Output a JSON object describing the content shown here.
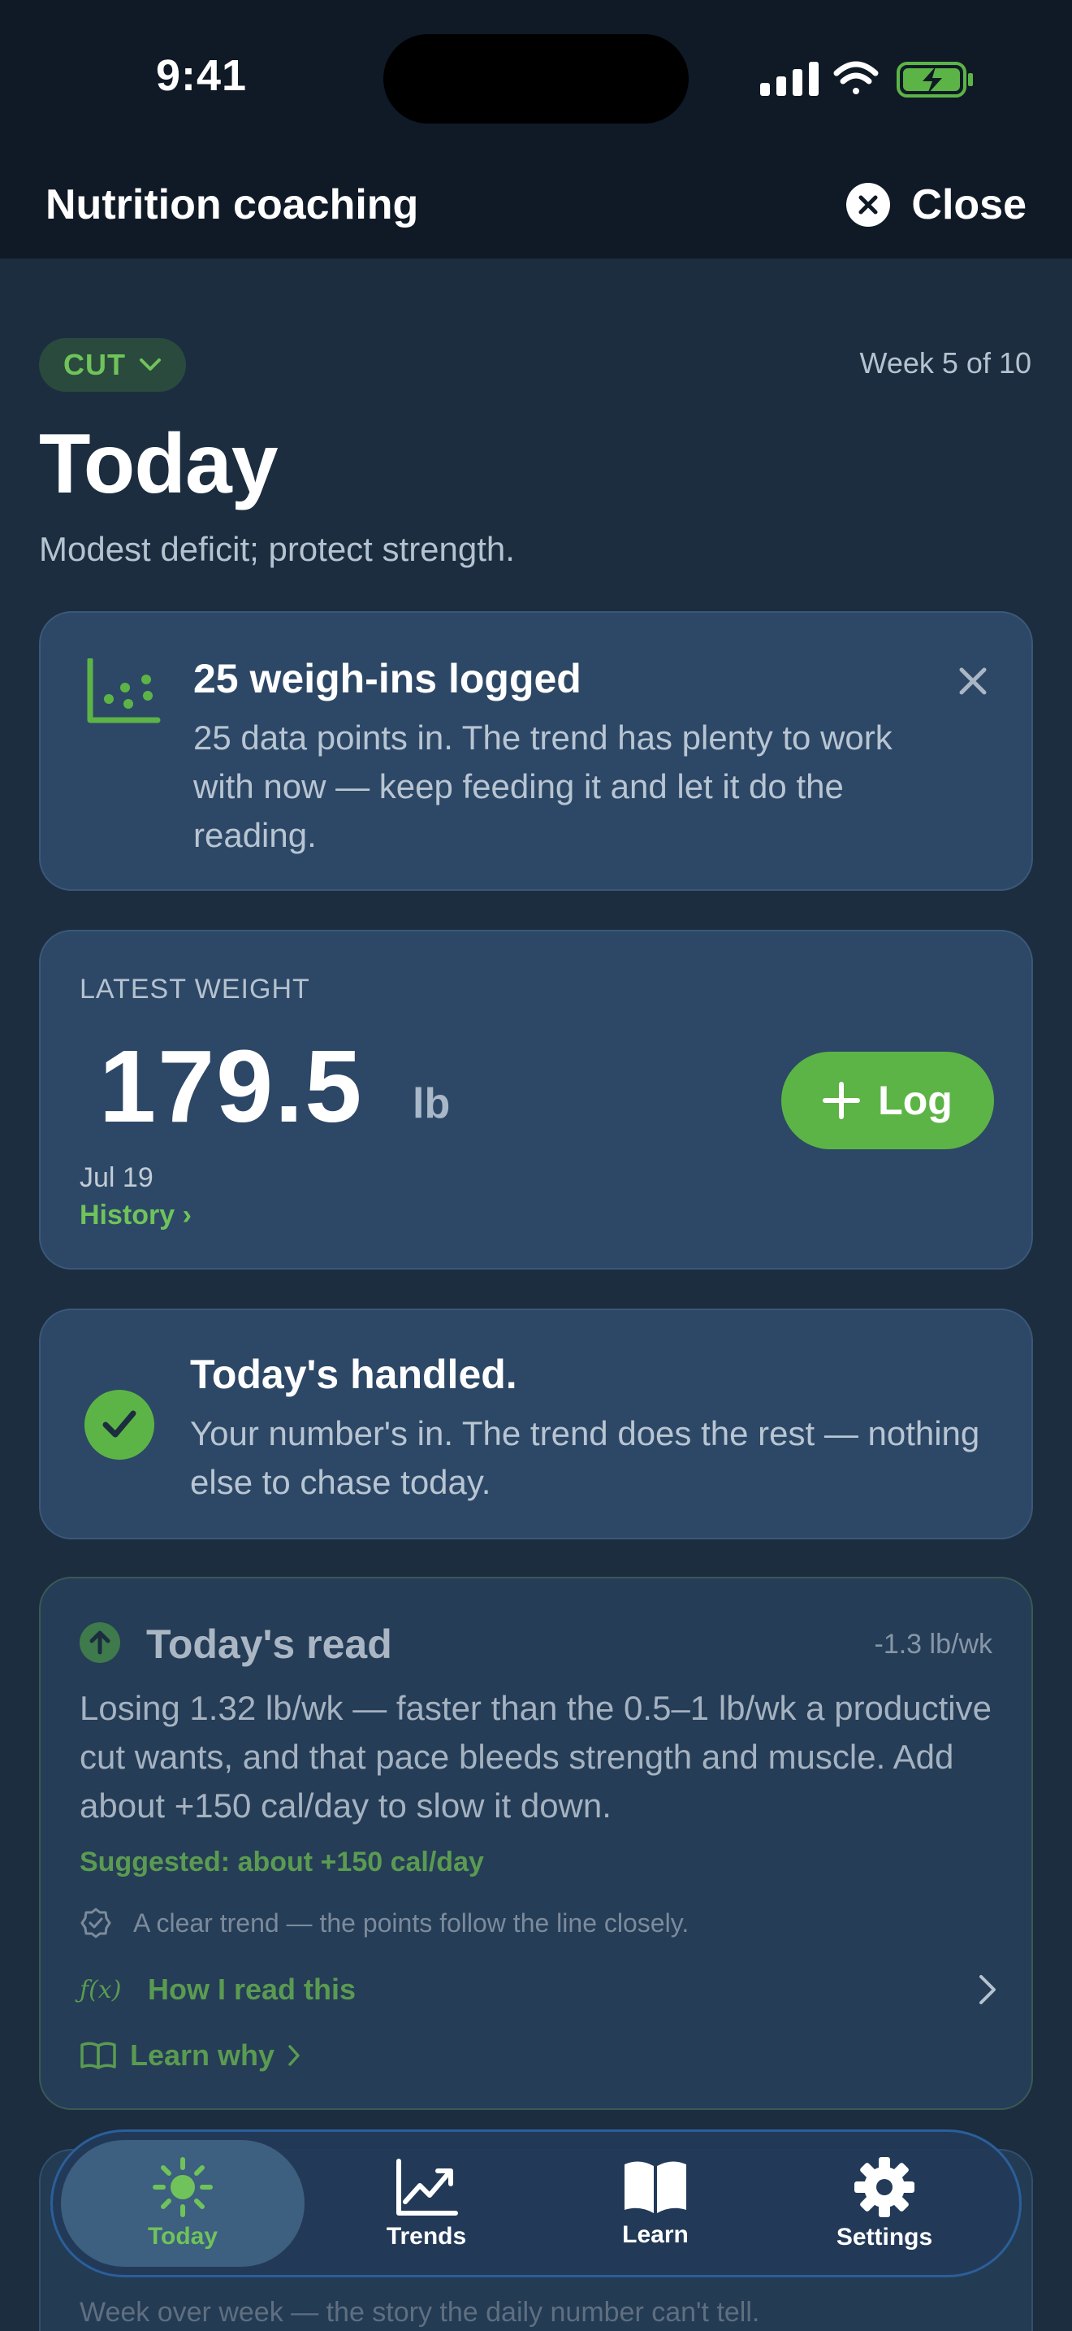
{
  "status_bar": {
    "time": "9:41"
  },
  "nav": {
    "title": "Nutrition coaching",
    "close_label": "Close"
  },
  "hero": {
    "phase_label": "CUT",
    "week_label": "Week 5 of 10",
    "title": "Today",
    "subtitle": "Modest deficit; protect strength."
  },
  "milestone": {
    "title": "25 weigh-ins logged",
    "body": "25 data points in. The trend has plenty to work with now — keep feeding it and let it do the reading."
  },
  "weight": {
    "label": "LATEST WEIGHT",
    "value": "179.5",
    "unit": "lb",
    "date": "Jul 19",
    "history_link": "History ›",
    "log_label": "Log"
  },
  "handled": {
    "title": "Today's handled.",
    "body": "Your number's in. The trend does the rest — nothing else to chase today."
  },
  "read": {
    "title": "Today's read",
    "rate": "-1.3 lb/wk",
    "body": "Losing 1.32 lb/wk — faster than the 0.5–1 lb/wk a productive cut wants, and that pace bleeds strength and muscle. Add about +150 cal/day to slow it down.",
    "suggestion": "Suggested: about +150 cal/day",
    "quality_note": "A clear trend — the points follow the line closely.",
    "howto_prefix": "ƒ(x)",
    "howto_label": "How I read this",
    "learn_label": "Learn why"
  },
  "peek_card": {
    "text": "Week over week — the story the daily number can't tell."
  },
  "tabs": [
    {
      "label": "Today",
      "icon": "sun-icon",
      "active": true
    },
    {
      "label": "Trends",
      "icon": "chart-line-icon",
      "active": false
    },
    {
      "label": "Learn",
      "icon": "book-icon",
      "active": false
    },
    {
      "label": "Settings",
      "icon": "gear-icon",
      "active": false
    }
  ],
  "colors": {
    "accent": "#5db446",
    "background": "#1c2d40",
    "card": "#2d4866",
    "header": "#0f1a26"
  }
}
